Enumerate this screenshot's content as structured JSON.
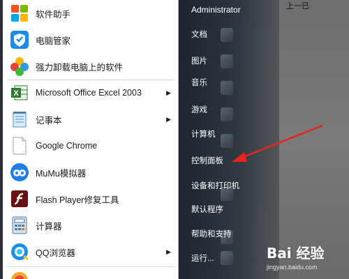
{
  "desktop": {
    "top_fragment": "上一已"
  },
  "programs": [
    {
      "label": "软件助手",
      "icon": "software-assistant-icon",
      "has_submenu": false
    },
    {
      "label": "电脑管家",
      "icon": "pc-manager-shield-icon",
      "has_submenu": false
    },
    {
      "label": "强力卸载电脑上的软件",
      "icon": "uninstaller-clover-icon",
      "has_submenu": false
    },
    {
      "label": "Microsoft Office Excel 2003",
      "icon": "excel-icon",
      "has_submenu": true
    },
    {
      "label": "记事本",
      "icon": "notepad-icon",
      "has_submenu": true
    },
    {
      "label": "Google Chrome",
      "icon": "chrome-icon",
      "has_submenu": false
    },
    {
      "label": "MuMu模拟器",
      "icon": "mumu-emulator-icon",
      "has_submenu": false
    },
    {
      "label": "Flash Player修复工具",
      "icon": "flash-player-icon",
      "has_submenu": false
    },
    {
      "label": "计算器",
      "icon": "calculator-icon",
      "has_submenu": false
    },
    {
      "label": "QQ浏览器",
      "icon": "qq-browser-icon",
      "has_submenu": true
    }
  ],
  "right_menu": {
    "user": "Administrator",
    "items": [
      "文档",
      "图片",
      "音乐",
      "游戏",
      "计算机",
      "控制面板",
      "设备和打印机",
      "默认程序",
      "帮助和支持",
      "运行..."
    ]
  },
  "watermark": {
    "logo": "Bai 经验",
    "url": "jingyan.baidu.com"
  },
  "colors": {
    "arrow": "#e8231e",
    "menu_bg": "#ffffff",
    "right_pane": "#1e2a36"
  }
}
